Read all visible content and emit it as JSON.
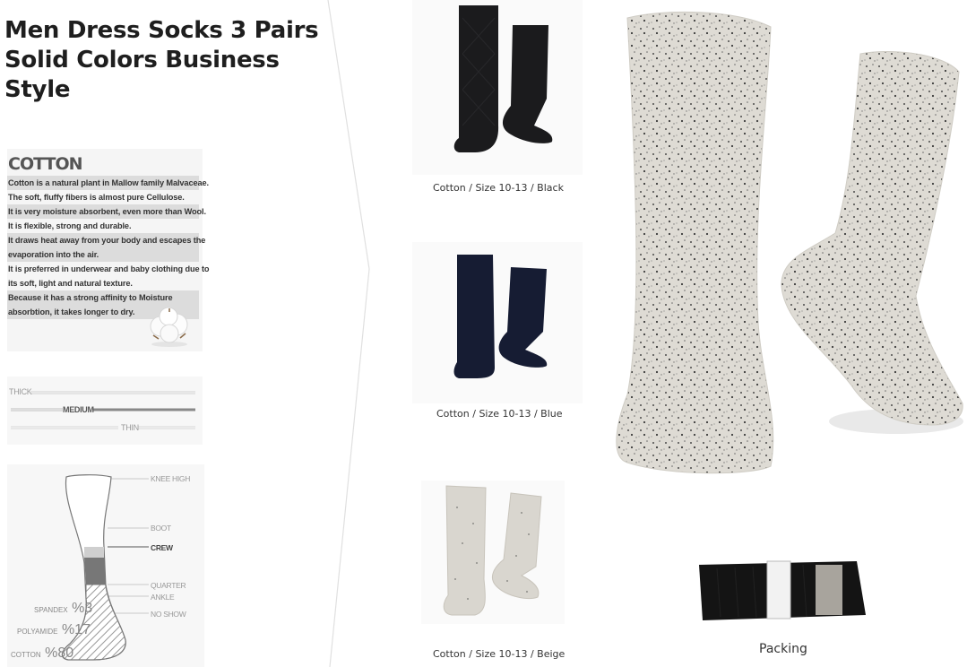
{
  "title": {
    "line1": "Men Dress Socks 3 Pairs",
    "line2": "Solid Colors Business Style"
  },
  "cotton": {
    "heading": "COTTON",
    "lines": [
      {
        "text": "Cotton is a natural plant in Mallow family Malvaceae.",
        "shade": true
      },
      {
        "text": "The soft, fluffy fibers is almost pure Cellulose.",
        "shade": false
      },
      {
        "text": "It is very  moisture absorbent, even more than Wool.",
        "shade": true
      },
      {
        "text": "It is flexible, strong and durable.",
        "shade": false
      },
      {
        "text": "It draws heat away from your body and escapes the",
        "shade": true
      },
      {
        "text": "evaporation  into the air.",
        "shade": true
      },
      {
        "text": "It is preferred in underwear and baby clothing due to",
        "shade": false
      },
      {
        "text": "its soft, light and natural texture.",
        "shade": false
      },
      {
        "text": "Because  it has a strong affinity to Moisture",
        "shade": true
      },
      {
        "text": "absorbtion, it takes longer to dry.",
        "shade": true
      }
    ]
  },
  "thickness": {
    "thick": "THICK",
    "medium": "MEDIUM",
    "thin": "THIN",
    "selected": "MEDIUM"
  },
  "sock_height": {
    "knee_high": "KNEE HIGH",
    "boot": "BOOT",
    "crew": "CREW",
    "quarter": "QUARTER",
    "ankle": "ANKLE",
    "no_show": "NO SHOW",
    "selected": "CREW"
  },
  "composition": {
    "spandex_label": "SPANDEX",
    "spandex_value": "%3",
    "polyamide_label": "POLYAMIDE",
    "polyamide_value": "%17",
    "cotton_label": "COTTON",
    "cotton_value": "%80"
  },
  "products": [
    {
      "caption": "Cotton / Size 10-13 / Black",
      "color": "#1b1b1d"
    },
    {
      "caption": "Cotton / Size 10-13 / Blue",
      "color": "#161c33"
    },
    {
      "caption": "Cotton / Size 10-13 / Beige",
      "color": "#d9d6cf"
    }
  ],
  "packing": {
    "caption": "Packing"
  },
  "colors": {
    "panel": "#f5f5f5",
    "shade": "#dcdcdc",
    "label_gray": "#999999"
  }
}
